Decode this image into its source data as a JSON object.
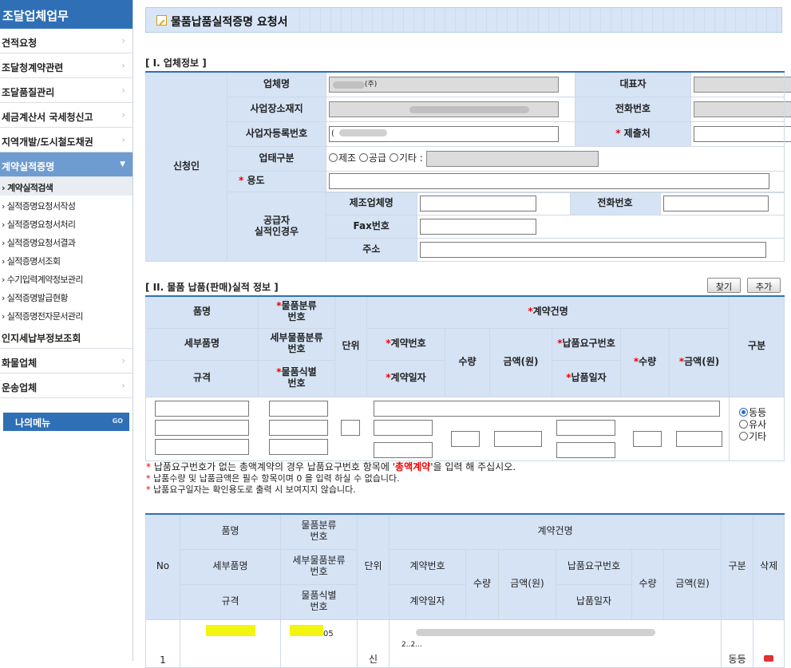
{
  "sidebar": {
    "title": "조달업체업무",
    "menus": [
      {
        "label": "견적요청"
      },
      {
        "label": "조달청계약관련"
      },
      {
        "label": "조달품질관리"
      },
      {
        "label": "세금계산서 국세청신고"
      },
      {
        "label": "지역개발/도시철도채권"
      },
      {
        "label": "계약실적증명"
      }
    ],
    "submenus": [
      {
        "label": "› 계약실적검색"
      },
      {
        "label": "› 실적증명요청서작성"
      },
      {
        "label": "› 실적증명요청서처리"
      },
      {
        "label": "› 실적증명요청서결과"
      },
      {
        "label": "› 실적증명서조회"
      },
      {
        "label": "› 수기입력계약정보관리"
      },
      {
        "label": "› 실적증명발급현황"
      },
      {
        "label": "› 실적증명전자문서관리"
      }
    ],
    "menus2": [
      {
        "label": "인지세납부정보조회"
      },
      {
        "label": "화물업체"
      },
      {
        "label": "운송업체"
      }
    ],
    "my_menu": "나의메뉴",
    "my_menu_go": "GO"
  },
  "page": {
    "title": "물품납품실적증명 요청서"
  },
  "section1": {
    "title": "[ I. 업체정보 ]",
    "applicant": "신청인",
    "company_name": "업체명",
    "company_value": "(주)",
    "ceo": "대표자",
    "address": "사업장소재지",
    "phone": "전화번호",
    "biz_no": "사업자등록번호",
    "biz_no_value": "(",
    "submit_to": "제출처",
    "biz_type": "업태구분",
    "biz_type_opts": [
      "제조",
      "공급",
      "기타 :"
    ],
    "purpose": "용도",
    "supplier": "공급자",
    "supplier2": "실적인경우",
    "maker": "제조업체명",
    "maker_phone": "전화번호",
    "fax": "Fax번호",
    "addr2": "주소"
  },
  "section2": {
    "title": "[ II. 물품 납품(판매)실적 정보 ]",
    "find_btn": "찾기",
    "add_btn": "추가",
    "h_item": "품명",
    "h_class": "물품분류",
    "h_class2": "번호",
    "h_contract_name": "계약건명",
    "h_detail": "세부품명",
    "h_detail_class": "세부물품분류",
    "h_detail_class2": "번호",
    "h_unit": "단위",
    "h_contract_no": "계약번호",
    "h_qty": "수량",
    "h_amount": "금액(원)",
    "h_req_no": "납품요구번호",
    "h_type": "구분",
    "h_spec": "규격",
    "h_ident": "물품식별",
    "h_ident2": "번호",
    "h_contract_date": "계약일자",
    "h_req_date": "납품일자",
    "radio": [
      "동등",
      "유사",
      "기타"
    ]
  },
  "notes": {
    "n1_a": "납품요구번호가 없는 총액계약의 경우 납품요구번호 항목에 '",
    "n1_b": "총액계약",
    "n1_c": "'을 입력 해 주십시오.",
    "n2": "납품수량 및 납품금액은 필수 항목이며 0 을 입력 하실 수 없습니다.",
    "n3": "납품요구일자는 확인용도로 출력 시 보여지지 않습니다.",
    "star": "*"
  },
  "list": {
    "no": "No",
    "item": "품명",
    "class": "물품분류",
    "class2": "번호",
    "contract_name": "계약건명",
    "detail": "세부품명",
    "detail_class": "세부물품분류",
    "detail_class2": "번호",
    "unit": "단위",
    "contract_no": "계약번호",
    "qty": "수량",
    "amount": "금액(원)",
    "req_no": "납품요구번호",
    "type": "구분",
    "delete": "삭제",
    "spec": "규격",
    "ident": "물품식별",
    "ident2": "번호",
    "contract_date": "계약일자",
    "req_date": "납품일자",
    "row": {
      "no": "1",
      "class_suffix": "05",
      "unit": "신",
      "contract_no_partial": "2..2...",
      "type": "동등"
    }
  }
}
